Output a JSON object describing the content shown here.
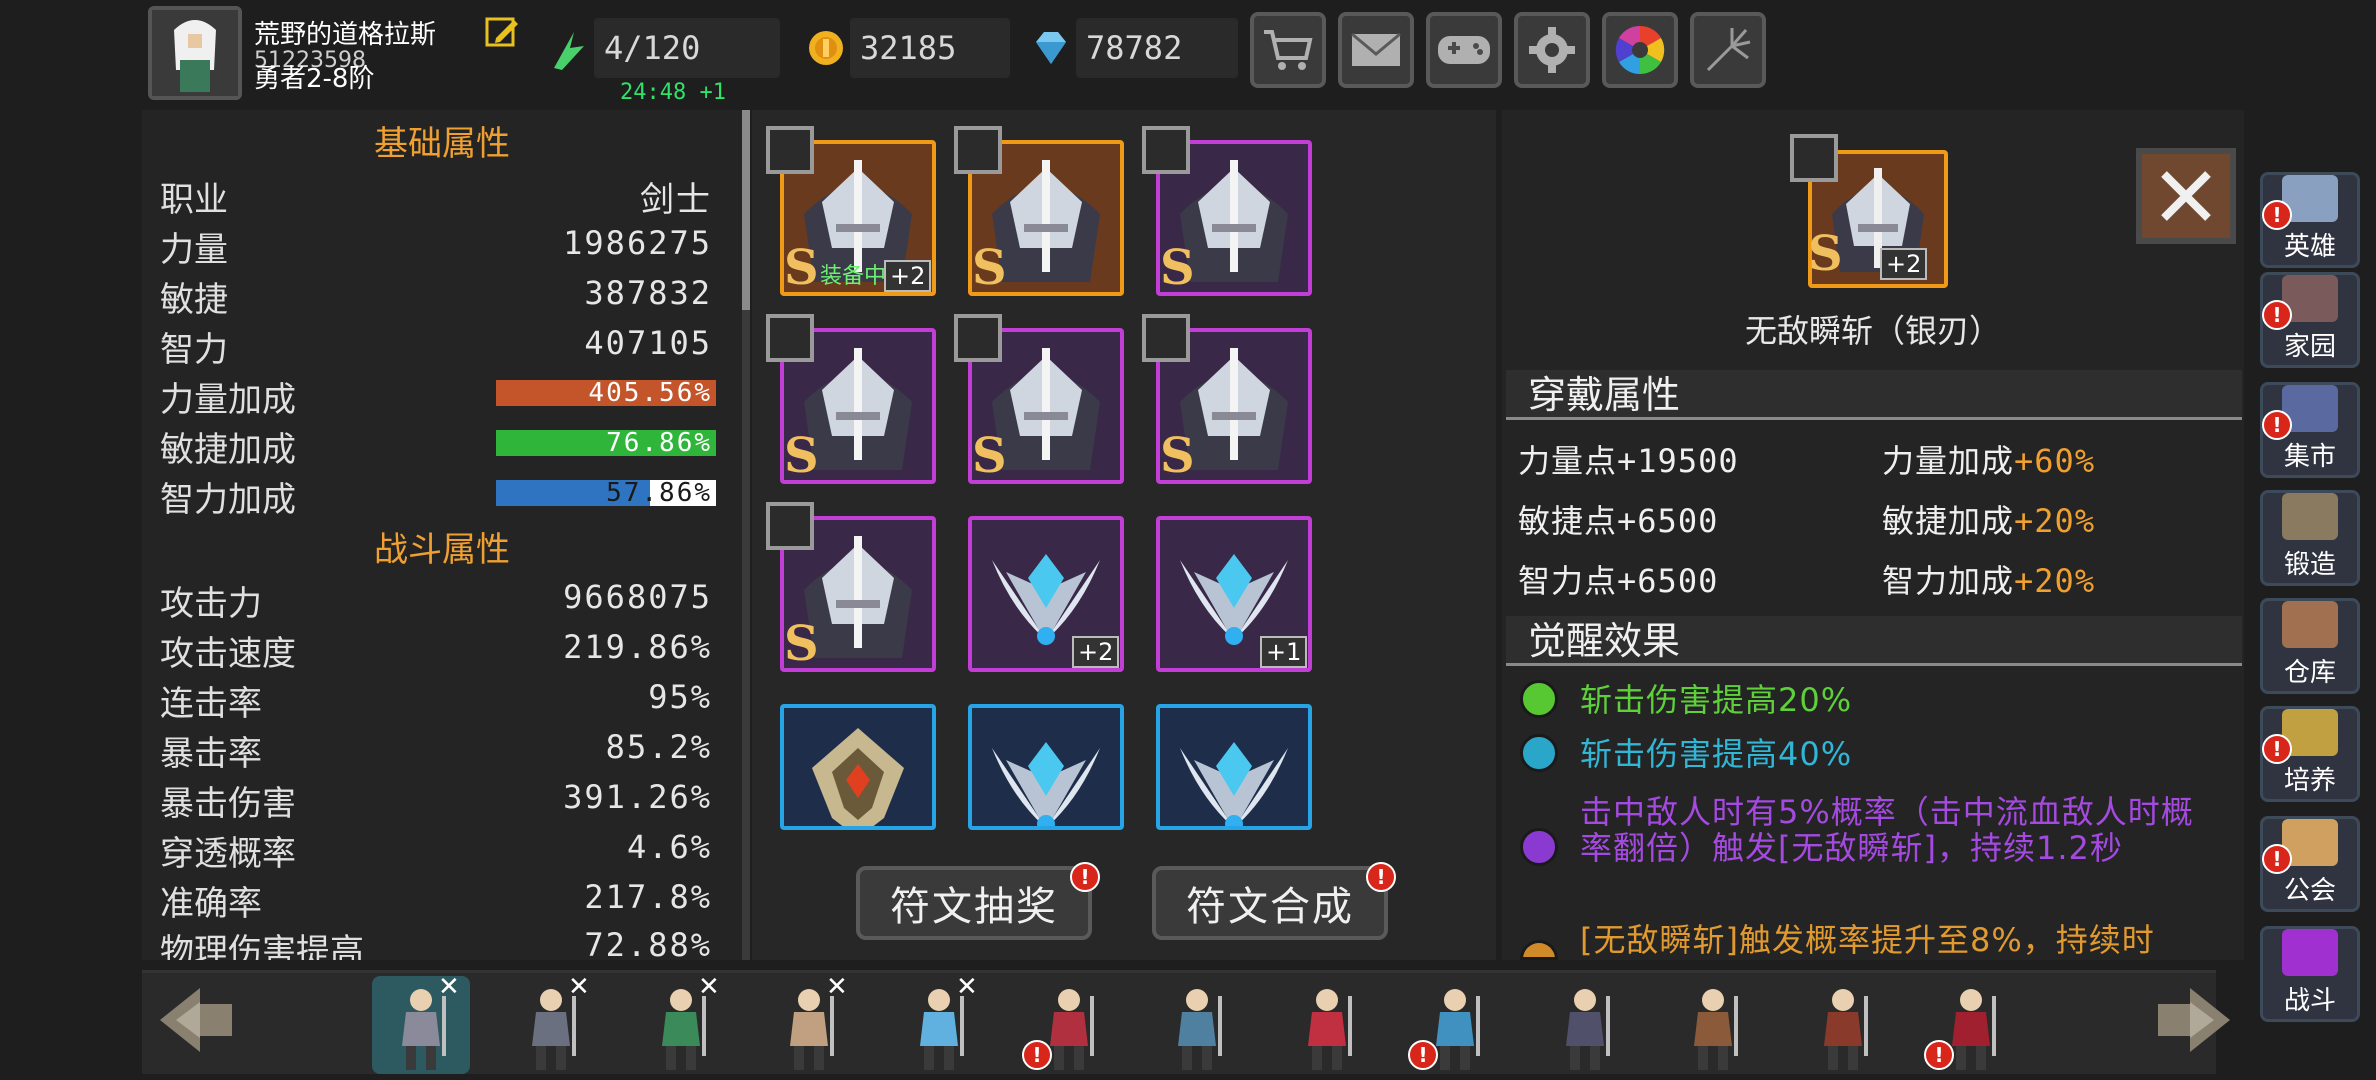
{
  "player": {
    "name": "荒野的道格拉斯",
    "uid": "51223598",
    "rank": "勇者2-8阶"
  },
  "resources": {
    "stamina": "4/120",
    "gold": "32185",
    "diamond": "78782",
    "timer": "24:48 +1"
  },
  "toolbar": {
    "icons": [
      "shop-cart-icon",
      "mail-icon",
      "gamepad-icon",
      "gear-icon",
      "color-wheel-icon",
      "fireworks-icon"
    ]
  },
  "basic": {
    "title": "基础属性",
    "rows": [
      {
        "label": "职业",
        "value": "剑士"
      },
      {
        "label": "力量",
        "value": "1986275"
      },
      {
        "label": "敏捷",
        "value": "387832"
      },
      {
        "label": "智力",
        "value": "407105"
      }
    ],
    "bars": [
      {
        "label": "力量加成",
        "value": "405.56%",
        "color": "#c4552a"
      },
      {
        "label": "敏捷加成",
        "value": "76.86%",
        "color": "#2fb63a"
      },
      {
        "label": "智力加成",
        "value": "57.86%",
        "color": "#2f74c0"
      }
    ]
  },
  "combat": {
    "title": "战斗属性",
    "rows": [
      {
        "label": "攻击力",
        "value": "9668075"
      },
      {
        "label": "攻击速度",
        "value": "219.86%"
      },
      {
        "label": "连击率",
        "value": "95%"
      },
      {
        "label": "暴击率",
        "value": "85.2%"
      },
      {
        "label": "暴击伤害",
        "value": "391.26%"
      },
      {
        "label": "穿透概率",
        "value": "4.6%"
      },
      {
        "label": "准确率",
        "value": "217.8%"
      },
      {
        "label": "物理伤害提高",
        "value": "72.88%"
      }
    ]
  },
  "runes": {
    "equipped_label": "装备中",
    "plus2": "+2",
    "plus1": "+1",
    "grade": "S"
  },
  "buttons": {
    "draw": "符文抽奖",
    "merge": "符文合成"
  },
  "detail": {
    "title": "无敌瞬斩（银刃）",
    "plus": "+2",
    "grade": "S",
    "wear_title": "穿戴属性",
    "wear": [
      {
        "k": "力量点",
        "v": "+19500",
        "k2": "力量加成",
        "v2": "+60%"
      },
      {
        "k": "敏捷点",
        "v": "+6500",
        "k2": "敏捷加成",
        "v2": "+20%"
      },
      {
        "k": "智力点",
        "v": "+6500",
        "k2": "智力加成",
        "v2": "+20%"
      }
    ],
    "awaken_title": "觉醒效果",
    "effects": [
      {
        "color": "#58c832",
        "text_color": "#5ed03a",
        "text": "斩击伤害提高20%"
      },
      {
        "color": "#2aa6c8",
        "text_color": "#32b6d6",
        "text": "斩击伤害提高40%"
      },
      {
        "color": "#8a3ad0",
        "text_color": "#a44ae0",
        "text": "击中敌人时有5%概率（击中流血敌人时概率翻倍）触发[无敌瞬斩]，持续1.2秒"
      },
      {
        "color": "#d08a2a",
        "text_color": "#e09a30",
        "text": "[无敌瞬斩]触发概率提升至8%，持续时"
      }
    ]
  },
  "sidenav": [
    {
      "label": "英雄",
      "alert": true,
      "color": "#8aa0c0"
    },
    {
      "label": "家园",
      "alert": true,
      "color": "#7a5a5a"
    },
    {
      "label": "集市",
      "alert": true,
      "color": "#5a6aa0"
    },
    {
      "label": "锻造",
      "alert": false,
      "color": "#8a7a60"
    },
    {
      "label": "仓库",
      "alert": false,
      "color": "#a07050"
    },
    {
      "label": "培养",
      "alert": true,
      "color": "#c0a040"
    },
    {
      "label": "公会",
      "alert": true,
      "color": "#d0a060"
    },
    {
      "label": "战斗",
      "alert": false,
      "color": "#a030d0"
    }
  ],
  "heroes": {
    "x_mark": "✕"
  }
}
